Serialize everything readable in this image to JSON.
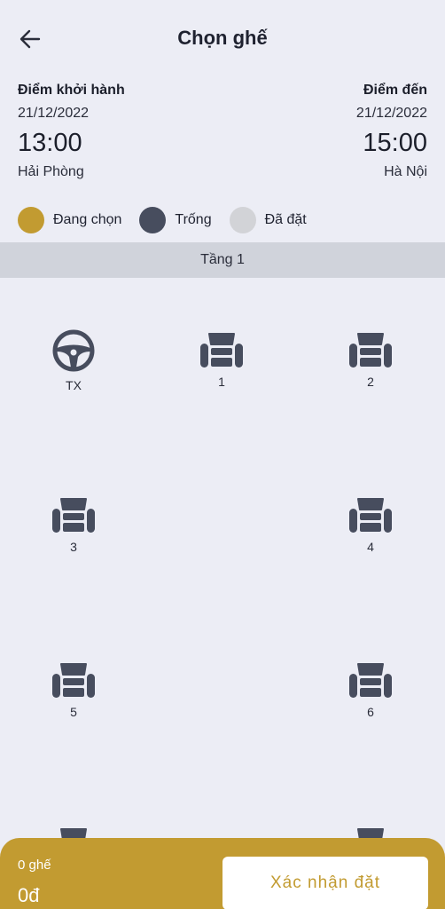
{
  "header": {
    "title": "Chọn ghế"
  },
  "trip": {
    "departure": {
      "label": "Điểm khởi hành",
      "date": "21/12/2022",
      "time": "13:00",
      "city": "Hải Phòng"
    },
    "arrival": {
      "label": "Điểm đến",
      "date": "21/12/2022",
      "time": "15:00",
      "city": "Hà Nội"
    }
  },
  "legend": [
    {
      "label": "Đang chọn",
      "color": "#c29b31"
    },
    {
      "label": "Trống",
      "color": "#474d5e"
    },
    {
      "label": "Đã đặt",
      "color": "#d2d3d7"
    }
  ],
  "floor": {
    "label": "Tầng 1"
  },
  "seats": {
    "driver": {
      "label": "TX",
      "icon": "steering-wheel-icon"
    },
    "list": [
      {
        "number": "1",
        "status": "available"
      },
      {
        "number": "2",
        "status": "available"
      },
      {
        "number": "3",
        "status": "available"
      },
      {
        "number": "4",
        "status": "available"
      },
      {
        "number": "5",
        "status": "available"
      },
      {
        "number": "6",
        "status": "available"
      }
    ],
    "icon": "seat-icon",
    "available_color": "#474d5e"
  },
  "footer": {
    "seat_count": "0 ghế",
    "total_price": "0đ",
    "confirm_label": "Xác nhận đặt",
    "accent_color": "#c29b31"
  }
}
